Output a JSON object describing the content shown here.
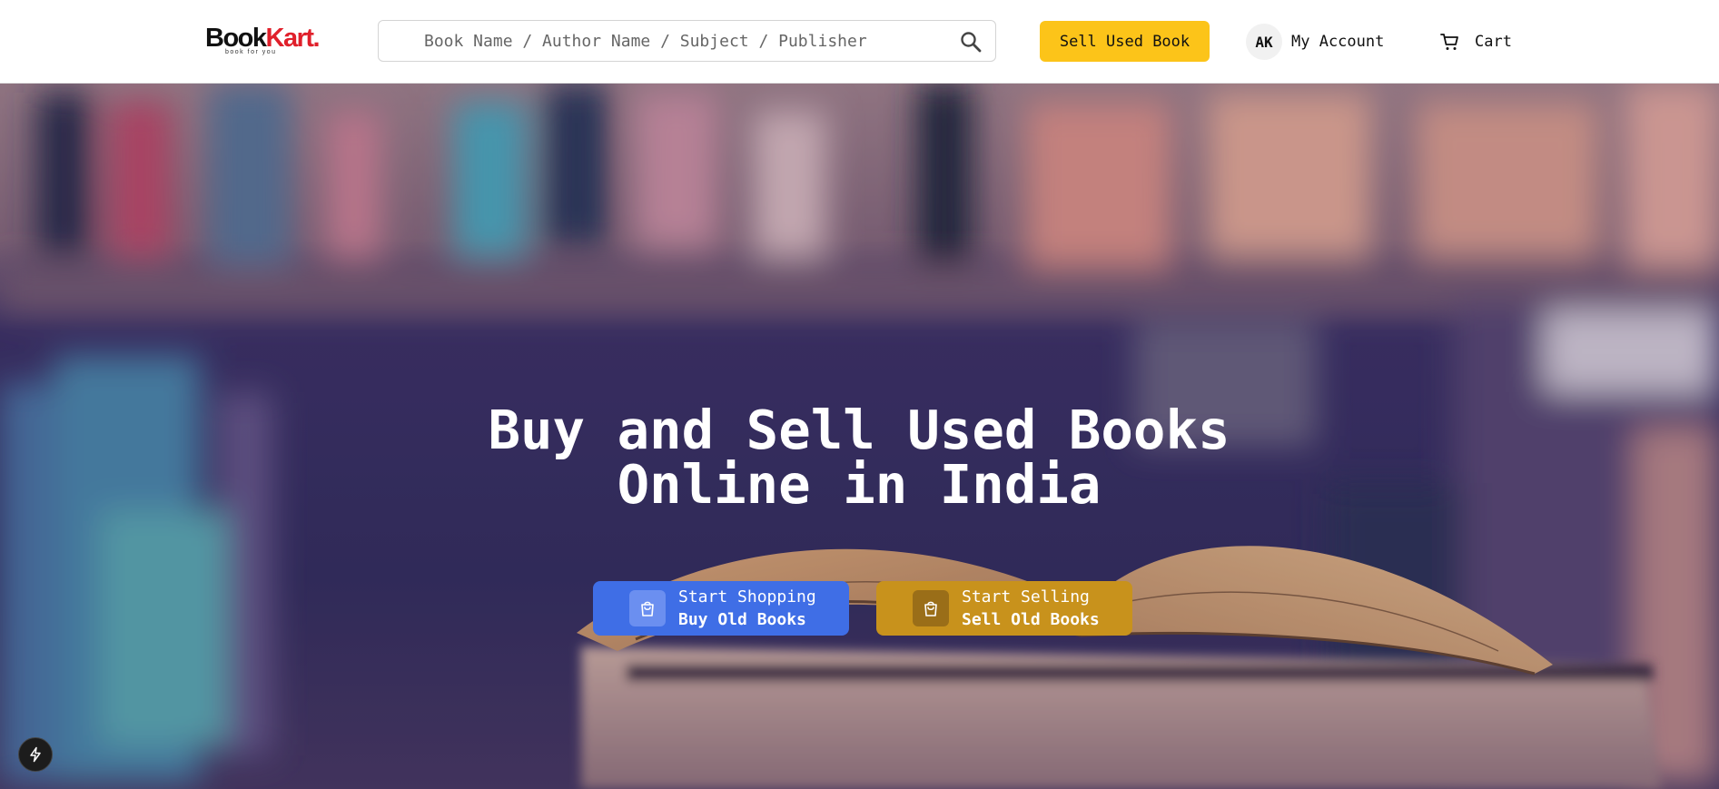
{
  "header": {
    "logo": {
      "brand_main": "Book",
      "brand_accent": "Kart.",
      "tagline": "book for you"
    },
    "search": {
      "placeholder": "Book Name / Author Name / Subject / Publisher",
      "icon": "search-icon"
    },
    "sell_button": "Sell Used Book",
    "account": {
      "initials": "AK",
      "label": "My Account"
    },
    "cart": {
      "label": "Cart",
      "icon": "cart-icon"
    }
  },
  "hero": {
    "title_line1": "Buy and Sell Used Books",
    "title_line2": "Online in India",
    "cta_shop": {
      "line1": "Start Shopping",
      "line2": "Buy Old Books",
      "icon": "shopping-bag-icon"
    },
    "cta_sell": {
      "line1": "Start Selling",
      "line2": "Sell Old Books",
      "icon": "shopping-bag-icon"
    }
  },
  "floating_button": {
    "icon": "lightning-icon"
  },
  "colors": {
    "accent_yellow": "#fcc419",
    "shop_blue": "#3f6ee6",
    "sell_gold": "#c8921c",
    "logo_red": "#e0202b"
  }
}
